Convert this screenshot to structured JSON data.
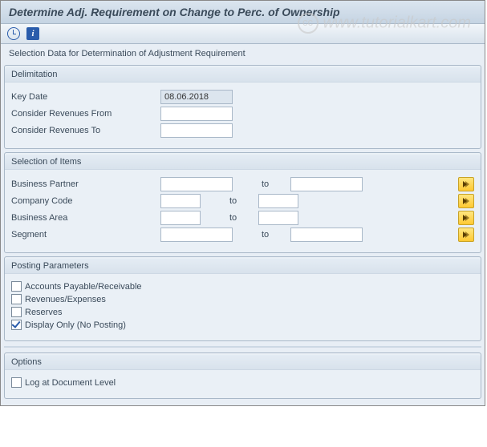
{
  "title": "Determine Adj. Requirement on Change to Perc. of Ownership",
  "watermark": "www.tutorialkart.com",
  "section_header": "Selection Data for Determination of Adjustment Requirement",
  "toolbar": {
    "info_glyph": "i"
  },
  "delimitation": {
    "title": "Delimitation",
    "key_date_label": "Key Date",
    "key_date_value": "08.06.2018",
    "rev_from_label": "Consider Revenues From",
    "rev_from_value": "",
    "rev_to_label": "Consider Revenues To",
    "rev_to_value": ""
  },
  "selection": {
    "title": "Selection of Items",
    "to_label": "to",
    "rows": [
      {
        "label": "Business Partner",
        "from": "",
        "to": "",
        "w": "w-bp"
      },
      {
        "label": "Company Code",
        "from": "",
        "to": "",
        "w": "w-cc"
      },
      {
        "label": "Business Area",
        "from": "",
        "to": "",
        "w": "w-cc"
      },
      {
        "label": "Segment",
        "from": "",
        "to": "",
        "w": "w-seg"
      }
    ]
  },
  "posting": {
    "title": "Posting Parameters",
    "items": [
      {
        "label": "Accounts Payable/Receivable",
        "checked": false
      },
      {
        "label": "Revenues/Expenses",
        "checked": false
      },
      {
        "label": "Reserves",
        "checked": false
      },
      {
        "label": "Display Only (No Posting)",
        "checked": true
      }
    ]
  },
  "options": {
    "title": "Options",
    "items": [
      {
        "label": "Log at Document Level",
        "checked": false
      }
    ]
  }
}
